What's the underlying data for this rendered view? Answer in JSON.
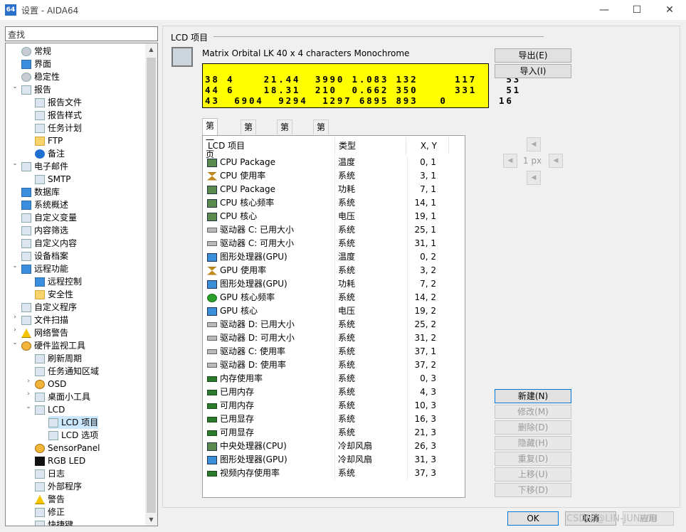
{
  "window": {
    "title": "设置 - AIDA64",
    "icon_text": "64",
    "minimize": "—",
    "maximize": "☐",
    "close": "✕"
  },
  "sidebar": {
    "search_placeholder": "查找",
    "items": [
      {
        "label": "常规",
        "level": 1,
        "icon": "gear-icon"
      },
      {
        "label": "界面",
        "level": 1,
        "icon": "monitor-icon"
      },
      {
        "label": "稳定性",
        "level": 1,
        "icon": "gear-icon"
      },
      {
        "label": "报告",
        "level": 1,
        "icon": "report-icon",
        "expanded": true
      },
      {
        "label": "报告文件",
        "level": 2,
        "icon": "file-icon"
      },
      {
        "label": "报告样式",
        "level": 2,
        "icon": "style-icon"
      },
      {
        "label": "任务计划",
        "level": 2,
        "icon": "schedule-icon"
      },
      {
        "label": "FTP",
        "level": 2,
        "icon": "folder-icon"
      },
      {
        "label": "备注",
        "level": 2,
        "icon": "info-icon"
      },
      {
        "label": "电子邮件",
        "level": 1,
        "icon": "mail-icon",
        "expanded": true
      },
      {
        "label": "SMTP",
        "level": 2,
        "icon": "server-icon"
      },
      {
        "label": "数据库",
        "level": 1,
        "icon": "database-icon"
      },
      {
        "label": "系统概述",
        "level": 1,
        "icon": "monitor-icon"
      },
      {
        "label": "自定义变量",
        "level": 1,
        "icon": "variable-icon"
      },
      {
        "label": "内容筛选",
        "level": 1,
        "icon": "filter-icon"
      },
      {
        "label": "自定义内容",
        "level": 1,
        "icon": "phone-icon"
      },
      {
        "label": "设备档案",
        "level": 1,
        "icon": "device-icon"
      },
      {
        "label": "远程功能",
        "level": 1,
        "icon": "remote-icon",
        "expanded": true
      },
      {
        "label": "远程控制",
        "level": 2,
        "icon": "remote-icon"
      },
      {
        "label": "安全性",
        "level": 2,
        "icon": "lock-icon"
      },
      {
        "label": "自定义程序",
        "level": 1,
        "icon": "program-icon"
      },
      {
        "label": "文件扫描",
        "level": 1,
        "icon": "scan-icon",
        "collapsed": true
      },
      {
        "label": "网络警告",
        "level": 1,
        "icon": "warning-icon",
        "collapsed": true
      },
      {
        "label": "硬件监视工具",
        "level": 1,
        "icon": "gauge-icon",
        "expanded": true
      },
      {
        "label": "刷新周期",
        "level": 2,
        "icon": "schedule-icon"
      },
      {
        "label": "任务通知区域",
        "level": 2,
        "icon": "tray-icon"
      },
      {
        "label": "OSD",
        "level": 2,
        "icon": "gauge-icon",
        "collapsed": true
      },
      {
        "label": "桌面小工具",
        "level": 2,
        "icon": "gadget-icon",
        "collapsed": true
      },
      {
        "label": "LCD",
        "level": 2,
        "icon": "lcd-icon",
        "expanded": true
      },
      {
        "label": "LCD 项目",
        "level": 3,
        "icon": "lcd-icon",
        "selected": true
      },
      {
        "label": "LCD 选项",
        "level": 3,
        "icon": "lcd-icon"
      },
      {
        "label": "SensorPanel",
        "level": 2,
        "icon": "gauge-icon"
      },
      {
        "label": "RGB LED",
        "level": 2,
        "icon": "rgb-icon"
      },
      {
        "label": "日志",
        "level": 2,
        "icon": "log-icon"
      },
      {
        "label": "外部程序",
        "level": 2,
        "icon": "program-icon"
      },
      {
        "label": "警告",
        "level": 2,
        "icon": "warning-icon"
      },
      {
        "label": "修正",
        "level": 2,
        "icon": "fix-icon"
      },
      {
        "label": "快捷键",
        "level": 2,
        "icon": "keyboard-icon"
      }
    ]
  },
  "main": {
    "group_title": "LCD 项目",
    "device_name": "Matrix Orbital LK 40 x 4 characters Monochrome",
    "lcd_lines": [
      "38 4    21.44  3990 1.083 132     117    53",
      "44 6    18.31  210  0.662 350     331    51",
      "43  6904  9294  1297 6895 893   0       16"
    ],
    "export_label": "导出(E)",
    "import_label": "导入(I)",
    "tabs": [
      "第一页",
      "第二页",
      "第三页",
      "第四页"
    ],
    "columns": [
      "LCD 项目",
      "类型",
      "X, Y"
    ],
    "rows": [
      {
        "name": "CPU Package",
        "type": "温度",
        "xy": "0, 1",
        "icon": "chip"
      },
      {
        "name": "CPU 使用率",
        "type": "系统",
        "xy": "3, 1",
        "icon": "hour"
      },
      {
        "name": "CPU Package",
        "type": "功耗",
        "xy": "7, 1",
        "icon": "chip"
      },
      {
        "name": "CPU 核心频率",
        "type": "系统",
        "xy": "14, 1",
        "icon": "chip"
      },
      {
        "name": "CPU 核心",
        "type": "电压",
        "xy": "19, 1",
        "icon": "chip"
      },
      {
        "name": "驱动器 C: 已用大小",
        "type": "系统",
        "xy": "25, 1",
        "icon": "drive"
      },
      {
        "name": "驱动器 C: 可用大小",
        "type": "系统",
        "xy": "31, 1",
        "icon": "drive"
      },
      {
        "name": "图形处理器(GPU)",
        "type": "温度",
        "xy": "0, 2",
        "icon": "gpu"
      },
      {
        "name": "GPU 使用率",
        "type": "系统",
        "xy": "3, 2",
        "icon": "hour"
      },
      {
        "name": "图形处理器(GPU)",
        "type": "功耗",
        "xy": "7, 2",
        "icon": "gpu"
      },
      {
        "name": "GPU 核心频率",
        "type": "系统",
        "xy": "14, 2",
        "icon": "xbox"
      },
      {
        "name": "GPU 核心",
        "type": "电压",
        "xy": "19, 2",
        "icon": "gpu"
      },
      {
        "name": "驱动器 D: 已用大小",
        "type": "系统",
        "xy": "25, 2",
        "icon": "drive"
      },
      {
        "name": "驱动器 D: 可用大小",
        "type": "系统",
        "xy": "31, 2",
        "icon": "drive"
      },
      {
        "name": "驱动器 C: 使用率",
        "type": "系统",
        "xy": "37, 1",
        "icon": "drive"
      },
      {
        "name": "驱动器 D: 使用率",
        "type": "系统",
        "xy": "37, 2",
        "icon": "drive"
      },
      {
        "name": "内存使用率",
        "type": "系统",
        "xy": "0, 3",
        "icon": "mem"
      },
      {
        "name": "已用内存",
        "type": "系统",
        "xy": "4, 3",
        "icon": "mem"
      },
      {
        "name": "可用内存",
        "type": "系统",
        "xy": "10, 3",
        "icon": "mem"
      },
      {
        "name": "已用显存",
        "type": "系统",
        "xy": "16, 3",
        "icon": "mem"
      },
      {
        "name": "可用显存",
        "type": "系统",
        "xy": "21, 3",
        "icon": "mem"
      },
      {
        "name": "中央处理器(CPU)",
        "type": "冷却风扇",
        "xy": "26, 3",
        "icon": "chip"
      },
      {
        "name": "图形处理器(GPU)",
        "type": "冷却风扇",
        "xy": "31, 3",
        "icon": "gpu"
      },
      {
        "name": "视频内存使用率",
        "type": "系统",
        "xy": "37, 3",
        "icon": "mem"
      }
    ],
    "px_label": "1 px",
    "new_label": "新建(N)",
    "modify_label": "修改(M)",
    "delete_label": "删除(D)",
    "hide_label": "隐藏(H)",
    "duplicate_label": "重复(D)",
    "up_label": "上移(U)",
    "down_label": "下移(D)"
  },
  "footer": {
    "ok_label": "OK",
    "cancel_label": "取消",
    "apply_label": "应用",
    "watermark": "CSDN @LIN-JUNWEI"
  },
  "colors": {
    "lcd_background": "#ffff00",
    "selection": "#cce8ff"
  }
}
